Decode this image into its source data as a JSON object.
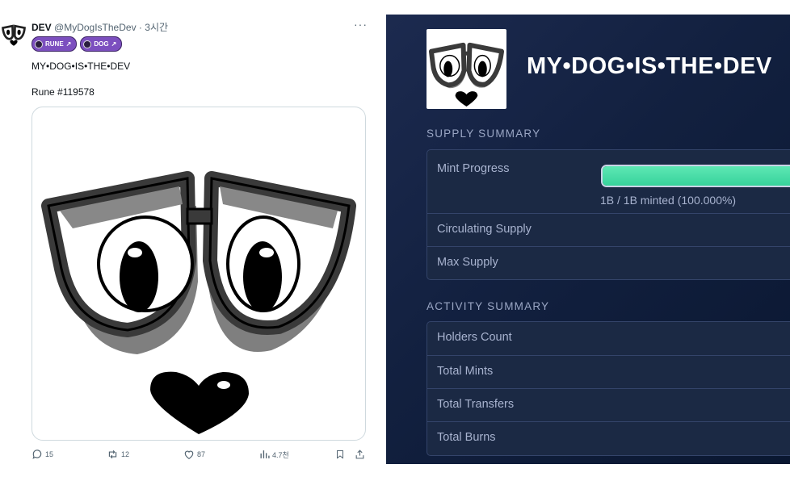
{
  "tweet": {
    "name": "DEV",
    "handle": "@MyDogIsTheDev",
    "separator": "·",
    "time": "3시간",
    "more": "···",
    "tags": [
      {
        "label": "RUNE",
        "arrow": "↗"
      },
      {
        "label": "DOG",
        "arrow": "↗"
      }
    ],
    "text_line1": "MY•DOG•IS•THE•DEV",
    "text_line2": "Rune #119578",
    "actions": {
      "replies": "15",
      "retweets": "12",
      "likes": "87",
      "views": "4.7천"
    }
  },
  "panel": {
    "title": "MY•DOG•IS•THE•DEV",
    "supply": {
      "heading": "SUPPLY SUMMARY",
      "mint_progress_label": "Mint Progress",
      "mint_progress_fraction": 1.0,
      "mint_progress_text": "1B / 1B minted (100.000%)",
      "circulating_label": "Circulating Supply",
      "max_label": "Max Supply"
    },
    "activity": {
      "heading": "ACTIVITY SUMMARY",
      "rows": [
        "Holders Count",
        "Total Mints",
        "Total Transfers",
        "Total Burns"
      ]
    }
  },
  "colors": {
    "panel_bg": "#12203f",
    "progress_fill": "#3fdca3",
    "tag_purple": "#7c4fbf"
  }
}
